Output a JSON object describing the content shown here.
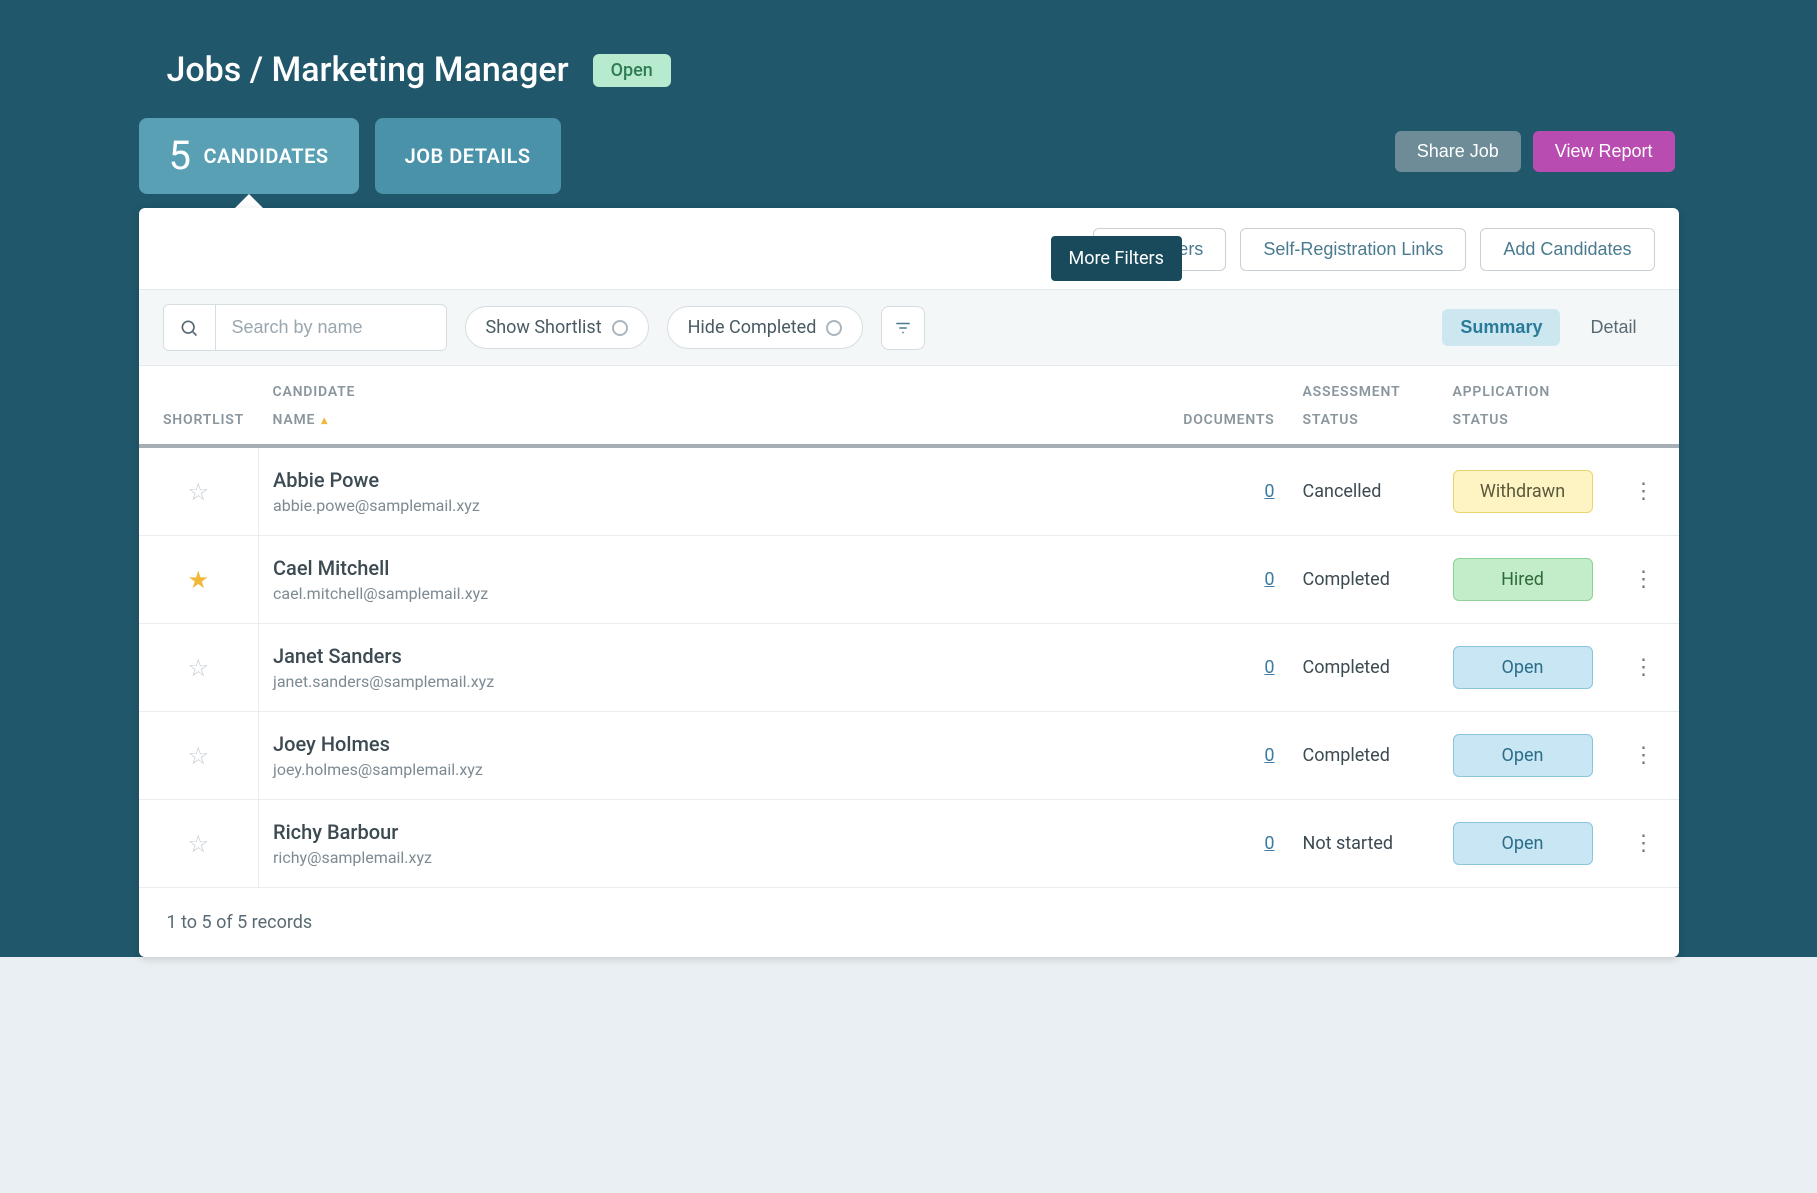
{
  "breadcrumb": "Jobs / Marketing Manager",
  "status_badge": "Open",
  "tabs": {
    "candidates_count": "5",
    "candidates_label": "CANDIDATES",
    "job_details_label": "JOB DETAILS"
  },
  "header_actions": {
    "share_job": "Share Job",
    "view_report": "View Report"
  },
  "panel_actions": {
    "reminders": "Reminders",
    "self_registration": "Self-Registration Links",
    "add_candidates": "Add Candidates",
    "more_filters_tooltip": "More Filters"
  },
  "filter_bar": {
    "search_placeholder": "Search by name",
    "show_shortlist": "Show Shortlist",
    "hide_completed": "Hide Completed",
    "summary": "Summary",
    "detail": "Detail"
  },
  "table": {
    "headers": {
      "shortlist": "SHORTLIST",
      "candidate_top": "CANDIDATE",
      "candidate_bottom": "NAME",
      "documents": "DOCUMENTS",
      "assessment_top": "ASSESSMENT",
      "assessment_bottom": "STATUS",
      "application_top": "APPLICATION",
      "application_bottom": "STATUS"
    },
    "rows": [
      {
        "shortlisted": false,
        "name": "Abbie Powe",
        "email": "abbie.powe@samplemail.xyz",
        "documents": "0",
        "assessment": "Cancelled",
        "application": "Withdrawn",
        "app_class": "app-withdrawn"
      },
      {
        "shortlisted": true,
        "name": "Cael Mitchell",
        "email": "cael.mitchell@samplemail.xyz",
        "documents": "0",
        "assessment": "Completed",
        "application": "Hired",
        "app_class": "app-hired"
      },
      {
        "shortlisted": false,
        "name": "Janet Sanders",
        "email": "janet.sanders@samplemail.xyz",
        "documents": "0",
        "assessment": "Completed",
        "application": "Open",
        "app_class": "app-open"
      },
      {
        "shortlisted": false,
        "name": "Joey Holmes",
        "email": "joey.holmes@samplemail.xyz",
        "documents": "0",
        "assessment": "Completed",
        "application": "Open",
        "app_class": "app-open"
      },
      {
        "shortlisted": false,
        "name": "Richy Barbour",
        "email": "richy@samplemail.xyz",
        "documents": "0",
        "assessment": "Not started",
        "application": "Open",
        "app_class": "app-open"
      }
    ]
  },
  "footer": "1 to 5 of 5 records"
}
